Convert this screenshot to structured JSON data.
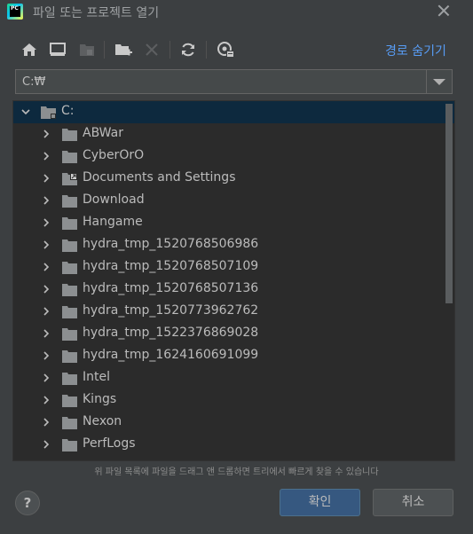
{
  "window": {
    "title": "파일 또는 프로젝트 열기"
  },
  "toolbar": {
    "hide_path_label": "경로 숨기기",
    "icons": [
      "home-icon",
      "desktop-icon",
      "project-icon",
      "new-folder-icon",
      "delete-icon",
      "refresh-icon",
      "show-hidden-icon"
    ]
  },
  "path": {
    "value": "C:₩"
  },
  "tree": {
    "root": {
      "label": "C:",
      "expanded": true
    },
    "items": [
      {
        "label": "ABWar",
        "icon": "folder"
      },
      {
        "label": "CyberOrO",
        "icon": "folder"
      },
      {
        "label": "Documents and Settings",
        "icon": "folder-link"
      },
      {
        "label": "Download",
        "icon": "folder"
      },
      {
        "label": "Hangame",
        "icon": "folder"
      },
      {
        "label": "hydra_tmp_1520768506986",
        "icon": "folder"
      },
      {
        "label": "hydra_tmp_1520768507109",
        "icon": "folder"
      },
      {
        "label": "hydra_tmp_1520768507136",
        "icon": "folder"
      },
      {
        "label": "hydra_tmp_1520773962762",
        "icon": "folder"
      },
      {
        "label": "hydra_tmp_1522376869028",
        "icon": "folder"
      },
      {
        "label": "hydra_tmp_1624160691099",
        "icon": "folder"
      },
      {
        "label": "Intel",
        "icon": "folder"
      },
      {
        "label": "Kings",
        "icon": "folder"
      },
      {
        "label": "Nexon",
        "icon": "folder"
      },
      {
        "label": "PerfLogs",
        "icon": "folder"
      }
    ]
  },
  "hint": "위 파일 목록에 파일을 드래그 앤 드롭하면 트리에서 빠르게 찾을 수 있습니다",
  "buttons": {
    "help": "?",
    "ok": "확인",
    "cancel": "취소"
  },
  "colors": {
    "background": "#3c3f41",
    "tree_background": "#2b2b2b",
    "selection": "#0d293e",
    "link": "#589df6",
    "ok_button": "#365880"
  }
}
